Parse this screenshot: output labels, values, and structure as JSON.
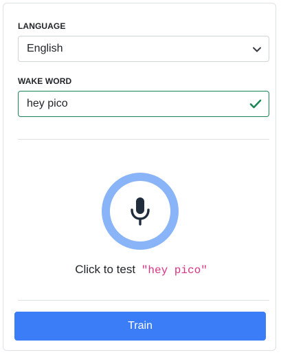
{
  "language": {
    "label": "LANGUAGE",
    "selected": "English"
  },
  "wake_word": {
    "label": "WAKE WORD",
    "value": "hey pico",
    "valid": true
  },
  "test": {
    "prefix": "Click to test",
    "phrase": "\"hey pico\""
  },
  "actions": {
    "train_label": "Train"
  },
  "colors": {
    "accent": "#3b7cf7",
    "mic_ring": "#8ab4f8",
    "valid_border": "#198754",
    "code_text": "#d63384"
  },
  "icons": {
    "select_arrow": "chevron-down-icon",
    "valid": "checkmark-icon",
    "mic": "microphone-icon"
  }
}
